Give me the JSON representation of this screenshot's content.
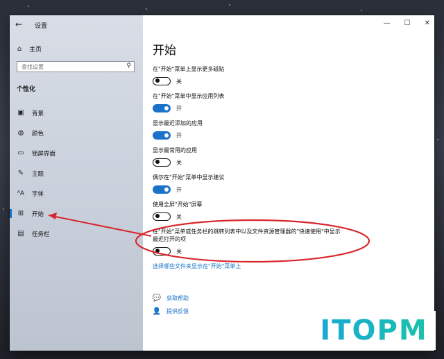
{
  "window": {
    "title": "设置",
    "back_glyph": "←",
    "controls": [
      "—",
      "☐",
      "✕"
    ]
  },
  "sidebar": {
    "home_label": "主页",
    "search_placeholder": "查找设置",
    "section_title": "个性化",
    "items": [
      {
        "label": "背景",
        "icon": "image-icon"
      },
      {
        "label": "颜色",
        "icon": "palette-icon"
      },
      {
        "label": "锁屏界面",
        "icon": "lock-screen-icon"
      },
      {
        "label": "主题",
        "icon": "theme-icon"
      },
      {
        "label": "字体",
        "icon": "font-icon"
      },
      {
        "label": "开始",
        "icon": "start-icon",
        "active": true
      },
      {
        "label": "任务栏",
        "icon": "taskbar-icon"
      }
    ]
  },
  "main": {
    "title": "开始",
    "settings": [
      {
        "label": "在\"开始\"菜单上显示更多磁贴",
        "state": "关",
        "on": false
      },
      {
        "label": "在\"开始\"菜单中显示应用列表",
        "state": "开",
        "on": true
      },
      {
        "label": "显示最近添加的应用",
        "state": "开",
        "on": true
      },
      {
        "label": "显示最常用的应用",
        "state": "关",
        "on": false
      },
      {
        "label": "偶尔在\"开始\"菜单中显示建议",
        "state": "开",
        "on": true
      },
      {
        "label": "使用全屏\"开始\"屏幕",
        "state": "关",
        "on": false
      },
      {
        "label": "在\"开始\"菜单或任务栏的跳转列表中以及文件资源管理器的\"快速使用\"中显示最近打开的项",
        "state": "关",
        "on": false
      }
    ],
    "choose_folders_link": "选择哪些文件夹显示在\"开始\"菜单上",
    "help_label": "获取帮助",
    "feedback_label": "提供反馈"
  },
  "annotation_color": "#d9262c",
  "accent_color": "#1a73c8",
  "watermark": "ITOPM"
}
